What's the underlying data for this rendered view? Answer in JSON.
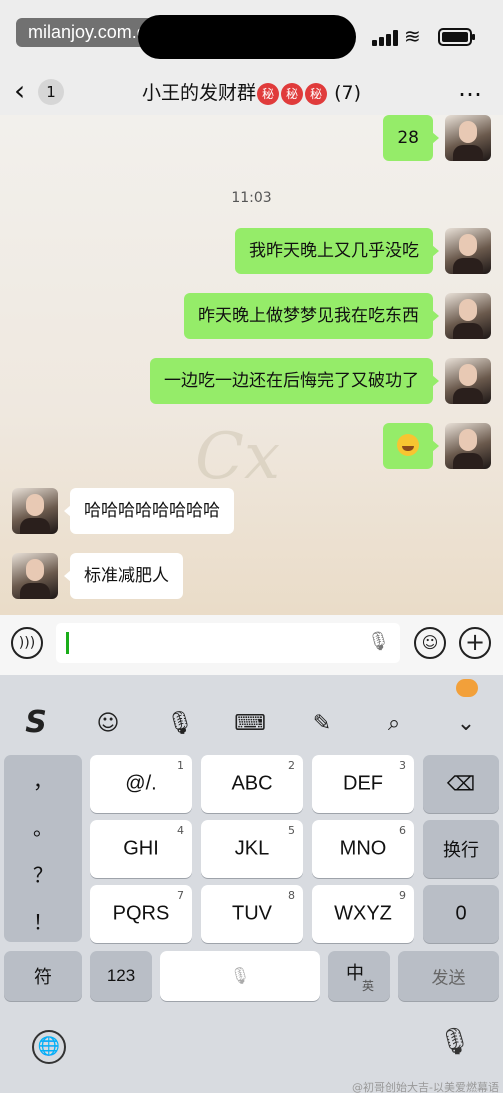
{
  "status_bar": {
    "site_watermark": "milanjoy.com.cn"
  },
  "header": {
    "back_count": "1",
    "title_prefix": "小王的发财群",
    "title_emoji": "秘",
    "member_count": "(7)",
    "more_icon": "…"
  },
  "chat": {
    "watermark": "Cx",
    "messages": [
      {
        "side": "right",
        "text": "28"
      },
      {
        "side": "system",
        "text": "11:03"
      },
      {
        "side": "right",
        "text": "我昨天晚上又几乎没吃"
      },
      {
        "side": "right",
        "text": "昨天晚上做梦梦见我在吃东西"
      },
      {
        "side": "right",
        "text": "一边吃一边还在后悔完了又破功了"
      },
      {
        "side": "right",
        "text": "",
        "emoji": "laughing-crying-face"
      },
      {
        "side": "left",
        "text": "哈哈哈哈哈哈哈哈"
      },
      {
        "side": "left",
        "text": "标准减肥人"
      }
    ]
  },
  "input_bar": {
    "voice_icon": "voice-toggle-icon",
    "emoji_icon": "emoji-icon",
    "plus_icon": "plus-icon",
    "value": ""
  },
  "keyboard": {
    "toolbar": [
      "S",
      "☺",
      "🎙",
      "⌨",
      "✎",
      "⌕",
      "⌄"
    ],
    "punctuation": [
      "，",
      "。",
      "？",
      "！"
    ],
    "keys": [
      {
        "label": "@/.",
        "num": "1"
      },
      {
        "label": "ABC",
        "num": "2"
      },
      {
        "label": "DEF",
        "num": "3"
      },
      {
        "label": "GHI",
        "num": "4"
      },
      {
        "label": "JKL",
        "num": "5"
      },
      {
        "label": "MNO",
        "num": "6"
      },
      {
        "label": "PQRS",
        "num": "7"
      },
      {
        "label": "TUV",
        "num": "8"
      },
      {
        "label": "WXYZ",
        "num": "9"
      }
    ],
    "delete_label": "⌫",
    "newline_label": "换行",
    "zero_label": "0",
    "symbol_label": "符",
    "num_label": "123",
    "space_mic": "🎙",
    "lang_main": "中",
    "lang_sub": "英",
    "send_label": "发送",
    "globe_icon": "🌐",
    "mic_icon": "🎙"
  },
  "bottom_watermark": "@初哥创始大吉-以美爱燃幕语"
}
